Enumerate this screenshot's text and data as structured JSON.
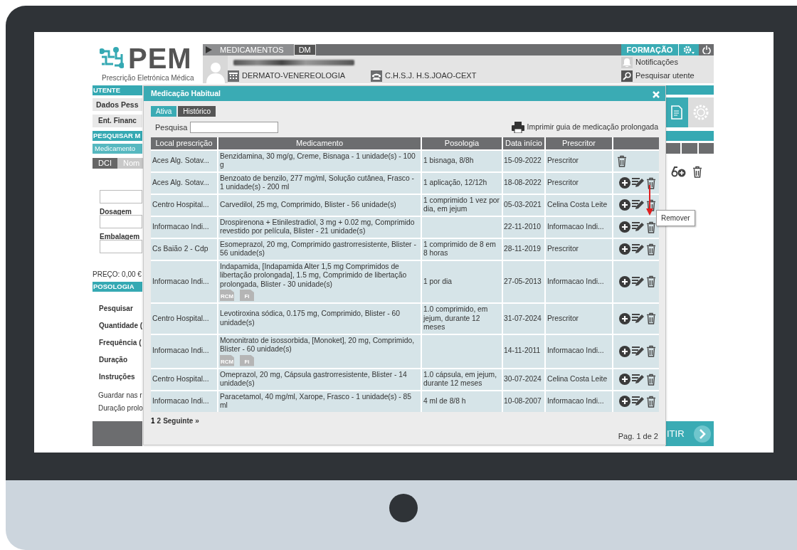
{
  "header": {
    "logo": {
      "title": "PEM",
      "subtitle": "Prescrição Eletrónica Médica"
    },
    "tabs": [
      {
        "label": "MEDICAMENTOS",
        "selected": true
      },
      {
        "label": "DM",
        "selected": false
      }
    ],
    "specialty": "DERMATO-VENEREOLOGIA",
    "institution": "C.H.S.J. H.S.JOAO-CEXT",
    "mode": "FORMAÇÃO",
    "links": [
      "Notificações",
      "Pesquisar utente"
    ]
  },
  "left_panel": [
    {
      "kind": "heading",
      "text": "UTENTE"
    },
    {
      "kind": "row",
      "text": "Dados Pess"
    },
    {
      "kind": "row",
      "text": "Ent. Financ"
    },
    {
      "kind": "heading",
      "text": "PESQUISAR M"
    },
    {
      "kind": "subtab",
      "text": "Medicamento"
    },
    {
      "kind": "tabs",
      "tabs": [
        {
          "label": "DCI",
          "selected": true
        },
        {
          "label": "Nom",
          "selected": false
        }
      ]
    },
    {
      "kind": "field"
    },
    {
      "kind": "label",
      "text": "Dosagem"
    },
    {
      "kind": "field"
    },
    {
      "kind": "label",
      "text": "Embalagem"
    },
    {
      "kind": "field"
    },
    {
      "kind": "text",
      "text": "PREÇO: 0,00 €"
    },
    {
      "kind": "heading",
      "text": "POSOLOGIA"
    },
    {
      "kind": "label",
      "text": "Pesquisar"
    },
    {
      "kind": "label",
      "text": "Quantidade ("
    },
    {
      "kind": "label",
      "text": "Frequência ("
    },
    {
      "kind": "label",
      "text": "Duração"
    },
    {
      "kind": "label",
      "text": "Instruções"
    },
    {
      "kind": "text",
      "text": "Guardar nas r"
    },
    {
      "kind": "text",
      "text": "Duração prolo"
    }
  ],
  "footer_button": "ITIR",
  "modal": {
    "title": "Medicação Habitual",
    "tabs": [
      {
        "label": "Ativa",
        "selected": true
      },
      {
        "label": "Histórico",
        "selected": false
      }
    ],
    "search_label": "Pesquisa",
    "print_link": "Imprimir guia de medicação prolongada",
    "columns": [
      "Local prescrição",
      "Medicamento",
      "Posologia",
      "Data início",
      "Prescritor"
    ],
    "rows": [
      {
        "local": "Aces Alg. Sotav...",
        "medicamento": "Benzidamina, 30 mg/g, Creme, Bisnaga - 1 unidade(s) - 100 g",
        "posologia": "1 bisnaga, 8/8h",
        "data": "15-09-2022",
        "prescritor": "Prescritor",
        "editable": false
      },
      {
        "local": "Aces Alg. Sotav...",
        "medicamento": "Benzoato de benzilo, 277 mg/ml, Solução cutânea, Frasco - 1 unidade(s) - 200 ml",
        "posologia": "1 aplicação, 12/12h",
        "data": "18-08-2022",
        "prescritor": "Prescritor",
        "editable": true
      },
      {
        "local": "Centro Hospital...",
        "medicamento": "Carvedilol, 25 mg, Comprimido, Blister - 56 unidade(s)",
        "posologia": "1 comprimido 1 vez por dia, em jejum",
        "data": "05-03-2021",
        "prescritor": "Celina Costa Leite",
        "editable": true
      },
      {
        "local": "Informacao Indi...",
        "medicamento": "Drospirenona + Etinilestradiol, 3 mg + 0.02 mg, Comprimido revestido por película, Blister - 21 unidade(s)",
        "data": "22-11-2010",
        "prescritor": "Informacao Indi...",
        "editable": true
      },
      {
        "local": "Cs Baião 2 - Cdp",
        "medicamento": "Esomeprazol, 20 mg, Comprimido gastrorresistente, Blister - 56 unidade(s)",
        "posologia": "1 comprimido de 8 em 8 horas",
        "data": "28-11-2019",
        "prescritor": "Prescritor",
        "editable": true
      },
      {
        "local": "Informacao Indi...",
        "medicamento": "Indapamida, [Indapamida Alter 1,5 mg Comprimidos de libertação prolongada], 1.5 mg, Comprimido de libertação prolongada, Blister - 30 unidade(s)",
        "documents": [
          "RCM",
          "Fi"
        ],
        "posologia": "1 por dia",
        "data": "27-05-2013",
        "prescritor": "Informacao Indi...",
        "editable": true
      },
      {
        "local": "Centro Hospital...",
        "medicamento": "Levotiroxina sódica, 0.175 mg, Comprimido, Blister - 60 unidade(s)",
        "posologia": "1.0 comprimido, em jejum, durante 12 meses",
        "data": "31-07-2024",
        "prescritor": "Prescritor",
        "editable": true
      },
      {
        "local": "Informacao Indi...",
        "medicamento": "Mononitrato de isossorbida, [Monoket], 20 mg, Comprimido, Blister - 60 unidade(s)",
        "documents": [
          "RCM",
          "Fi"
        ],
        "data": "14-11-2011",
        "prescritor": "Informacao Indi...",
        "editable": true
      },
      {
        "local": "Centro Hospital...",
        "medicamento": "Omeprazol, 20 mg, Cápsula gastrorresistente, Blister - 14 unidade(s)",
        "posologia": "1.0 cápsula, em jejum, durante 12 meses",
        "data": "30-07-2024",
        "prescritor": "Celina Costa Leite",
        "editable": true
      },
      {
        "local": "Informacao Indi...",
        "medicamento": "Paracetamol, 40 mg/ml, Xarope, Frasco - 1 unidade(s) - 85 ml",
        "posologia": "4 ml de 8/8 h",
        "data": "10-08-2007",
        "prescritor": "Informacao Indi...",
        "editable": true
      }
    ],
    "pagination": {
      "pages": [
        {
          "label": "1",
          "selected": true
        },
        {
          "label": "2",
          "selected": false
        }
      ],
      "next": "Seguinte »",
      "summary": "Pag. 1 de 2"
    }
  },
  "tooltip": "Remover"
}
